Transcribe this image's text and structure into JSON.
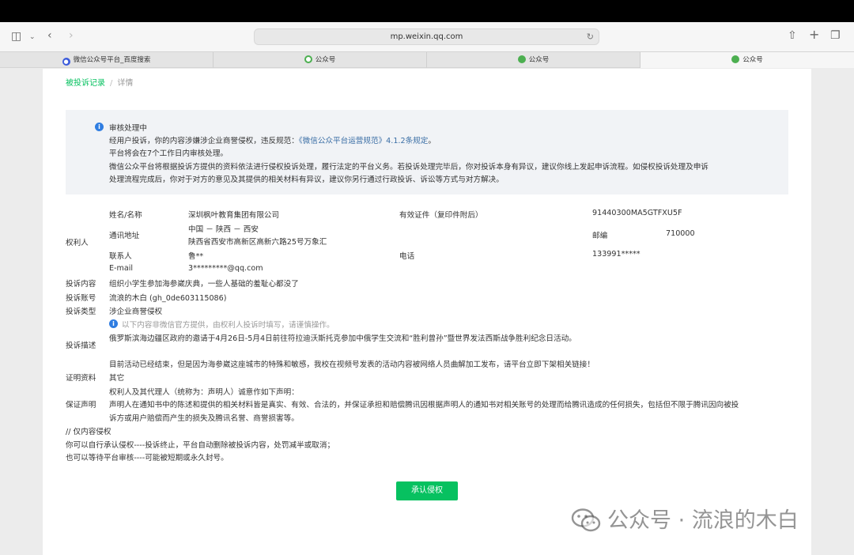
{
  "browser": {
    "url": "mp.weixin.qq.com",
    "tabs": [
      {
        "label": "微信公众号平台_百度搜索",
        "icon": "baidu-icon"
      },
      {
        "label": "公众号",
        "icon": "wechat-mp-icon"
      },
      {
        "label": "公众号",
        "icon": "wechat-icon"
      },
      {
        "label": "公众号",
        "icon": "wechat-icon",
        "active": true
      }
    ]
  },
  "breadcrumb": {
    "link": "被投诉记录",
    "sep": "/",
    "current": "详情"
  },
  "notice": {
    "title": "审核处理中",
    "line1_pre": "经用户投诉，你的内容涉嫌涉企业商誉侵权，违反规范：",
    "line1_link": "《微信公众平台运营规范》4.1.2条规定",
    "line1_post": "。",
    "line2": "平台将会在7个工作日内审核处理。",
    "line3": "微信公众平台将根据投诉方提供的资料依法进行侵权投诉处理，履行法定的平台义务。若投诉处理完毕后，你对投诉本身有异议，建议你线上发起申诉流程。如侵权投诉处理及申诉",
    "line4": "处理流程完成后，你对于对方的意见及其提供的相关材料有异议，建议你另行通过行政投诉、诉讼等方式与对方解决。"
  },
  "rights_holder": {
    "section": "权利人",
    "name_label": "姓名/名称",
    "name": "深圳枫叶教育集团有限公司",
    "cert_label": "有效证件（复印件附后）",
    "cert": "91440300MA5GTFXU5F",
    "addr_label": "通讯地址",
    "addr1": "中国 － 陕西 － 西安",
    "addr2": "陕西省西安市高新区高新六路25号万象汇",
    "zip_label": "邮编",
    "zip": "710000",
    "contact_label": "联系人",
    "contact": "鲁**",
    "phone_label": "电话",
    "phone": "133991*****",
    "email_label": "E-mail",
    "email": "3*********@qq.com"
  },
  "complaint": {
    "content_label": "投诉内容",
    "content": "组织小学生参加海参崴庆典，一些人基础的羞耻心都没了",
    "account_label": "投诉账号",
    "account": "流浪的木白  (gh_0de603115086)",
    "type_label": "投诉类型",
    "type": "涉企业商誉侵权",
    "hint": "以下内容非微信官方提供，由权利人投诉时填写，请谨慎操作。",
    "desc_label": "投诉描述",
    "desc1": "俄罗斯滨海边疆区政府的邀请于4月26日-5月4日前往符拉迪沃斯托克参加中俄学生交流和“胜利曾孙”暨世界发法西斯战争胜利纪念日活动。",
    "desc2": "目前活动已经结束，但是因为海参崴这座城市的特殊和敏感，我校在视频号发表的活动内容被网络人员曲解加工发布，请平台立即下架相关链接！",
    "proof_label": "证明资料",
    "proof": "其它",
    "decl_label": "保证声明",
    "decl1": "权利人及其代理人（统称为：声明人）诚意作如下声明：",
    "decl2": "声明人在通知书中的陈述和提供的相关材料皆是真实、有效、合法的，并保证承担和赔偿腾讯因根据声明人的通知书对相关账号的处理而给腾讯造成的任何损失，包括但不限于腾讯因向被投",
    "decl3": "诉方或用户赔偿而产生的损失及腾讯名誉、商誉损害等。"
  },
  "comment": {
    "l1": "// 仅内容侵权",
    "l2": "你可以自行承认侵权----投诉终止，平台自动删除被投诉内容，处罚减半或取消；",
    "l3": "也可以等待平台审核----可能被短期或永久封号。"
  },
  "button": {
    "label": "承认侵权"
  },
  "watermark": {
    "text": "公众号 · 流浪的木白"
  },
  "colors": {
    "accent": "#07c160",
    "link": "#3a6ea5",
    "info": "#2f7de1"
  }
}
